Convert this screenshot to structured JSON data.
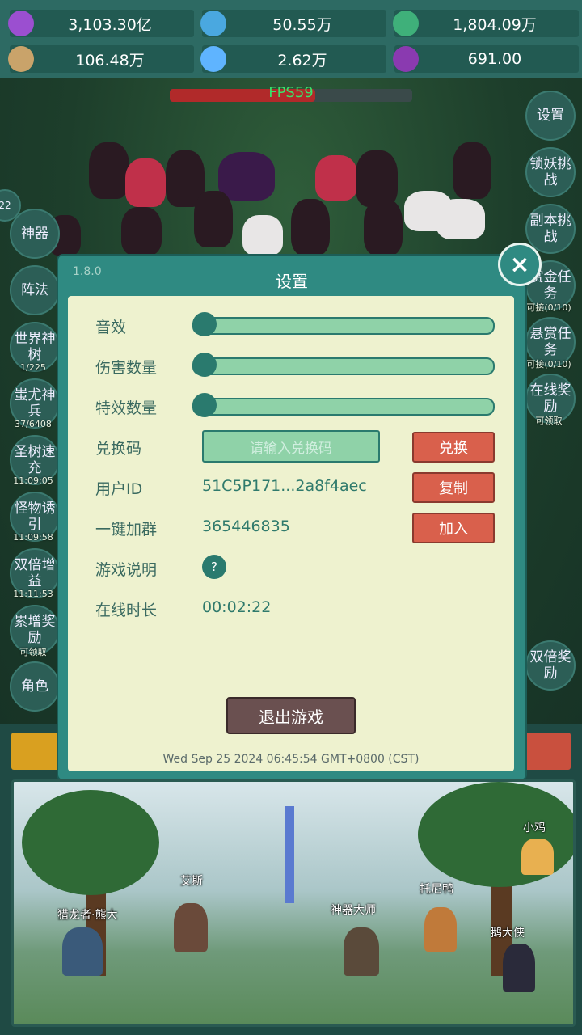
{
  "resources": [
    {
      "icon": "purple-gem-icon",
      "value": "3,103.30亿",
      "color": "#9b4fd0"
    },
    {
      "icon": "blue-crystal-icon",
      "value": "50.55万",
      "color": "#4aa8e0"
    },
    {
      "icon": "green-orb-icon",
      "value": "1,804.09万",
      "color": "#3fb07a"
    },
    {
      "icon": "scroll-icon",
      "value": "106.48万",
      "color": "#c9a36a"
    },
    {
      "icon": "blue-shard-icon",
      "value": "2.62万",
      "color": "#5fb4ff"
    },
    {
      "icon": "potion-icon",
      "value": "691.00",
      "color": "#8a3ab0"
    }
  ],
  "fps": "FPS59",
  "level_badge": "22",
  "left_menu": [
    {
      "label": "神器",
      "sub": ""
    },
    {
      "label": "阵法",
      "sub": ""
    },
    {
      "label": "世界神树",
      "sub": "1/225"
    },
    {
      "label": "蚩尤神兵",
      "sub": "37/6408"
    },
    {
      "label": "圣树速充",
      "sub": "11:09:05"
    },
    {
      "label": "怪物诱引",
      "sub": "11:09:58"
    },
    {
      "label": "双倍增益",
      "sub": "11:11:53"
    },
    {
      "label": "累增奖励",
      "sub": "可领取"
    },
    {
      "label": "角色",
      "sub": ""
    }
  ],
  "right_menu": [
    {
      "label": "设置",
      "sub": ""
    },
    {
      "label": "锁妖挑战",
      "sub": ""
    },
    {
      "label": "副本挑战",
      "sub": ""
    },
    {
      "label": "赏金任务",
      "sub": "可接(0/10)"
    },
    {
      "label": "悬赏任务",
      "sub": "可接(0/10)"
    },
    {
      "label": "在线奖励",
      "sub": "可领取"
    },
    {
      "label": "双倍奖励",
      "sub": ""
    }
  ],
  "dialog": {
    "version": "1.8.0",
    "title": "设置",
    "close_icon": "×",
    "sound_label": "音效",
    "sound_level": 0,
    "damage_label": "伤害数量",
    "damage_level": 0,
    "effects_label": "特效数量",
    "effects_level": 0,
    "code_label": "兑换码",
    "code_placeholder": "请输入兑换码",
    "redeem_button": "兑换",
    "uid_label": "用户ID",
    "uid_value": "51C5P171...2a8f4aec",
    "copy_button": "复制",
    "group_label": "一键加群",
    "group_value": "365446835",
    "join_button": "加入",
    "help_label": "游戏说明",
    "help_icon": "?",
    "online_label": "在线时长",
    "online_value": "00:02:22",
    "exit_button": "退出游戏",
    "datetime": "Wed Sep 25 2024 06:45:54 GMT+0800 (CST)"
  },
  "scene": {
    "heroes": [
      "猎龙者·熊大",
      "艾斯",
      "神器大师",
      "托尼鸭",
      "小鸡",
      "鹅大侠"
    ]
  }
}
